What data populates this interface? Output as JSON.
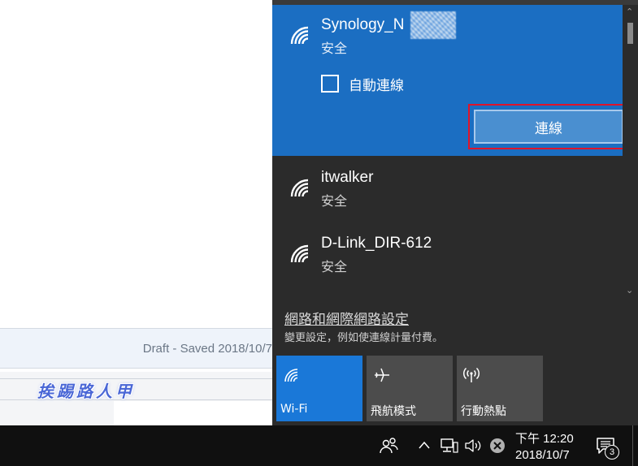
{
  "background_app": {
    "status_text": "Draft - Saved 2018/10/7",
    "watermark": "挨踢路人甲"
  },
  "networks": [
    {
      "name": "Synology_N",
      "status": "安全",
      "selected": true
    },
    {
      "name": "itwalker",
      "status": "安全",
      "selected": false
    },
    {
      "name": "D-Link_DIR-612",
      "status": "安全",
      "selected": false
    }
  ],
  "selected_network": {
    "auto_connect_label": "自動連線",
    "connect_button": "連線"
  },
  "settings": {
    "link": "網路和網際網路設定",
    "description": "變更設定，例如使連線計量付費。"
  },
  "quick_actions": [
    {
      "label": "Wi-Fi",
      "icon": "wifi-icon",
      "active": true
    },
    {
      "label": "飛航模式",
      "icon": "airplane-icon",
      "active": false
    },
    {
      "label": "行動熱點",
      "icon": "hotspot-icon",
      "active": false
    }
  ],
  "taskbar": {
    "time": "下午 12:20",
    "date": "2018/10/7",
    "notification_count": "3"
  },
  "colors": {
    "accent": "#1b6ec2",
    "tile_active": "#1a78d8",
    "highlight": "#e0142a"
  }
}
